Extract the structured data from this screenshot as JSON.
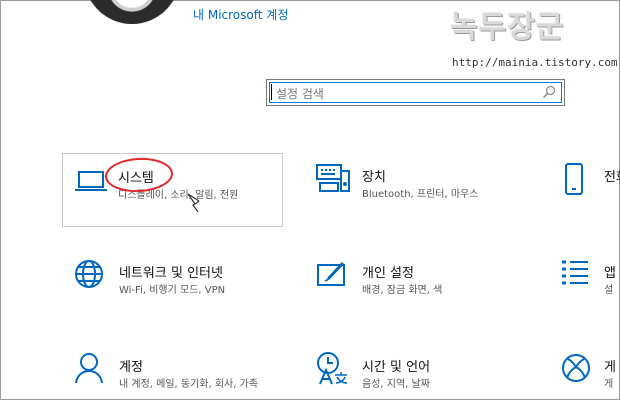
{
  "account": {
    "link_text": "내 Microsoft 계정"
  },
  "watermark": {
    "title": "녹두장군",
    "url": "http://mainia.tistory.com"
  },
  "search": {
    "placeholder": "설정 검색",
    "icon": "search-icon"
  },
  "tiles": [
    {
      "id": "system",
      "title": "시스템",
      "desc": "디스플레이, 소리, 알림, 전원",
      "icon": "laptop-icon",
      "selected": true
    },
    {
      "id": "devices",
      "title": "장치",
      "desc": "Bluetooth, 프린터, 마우스",
      "icon": "keyboard-devices-icon"
    },
    {
      "id": "phone",
      "title": "전화",
      "desc": "",
      "icon": "phone-icon"
    },
    {
      "id": "network",
      "title": "네트워크 및 인터넷",
      "desc": "Wi-Fi, 비행기 모드, VPN",
      "icon": "globe-icon"
    },
    {
      "id": "personalization",
      "title": "개인 설정",
      "desc": "배경, 잠금 화면, 색",
      "icon": "paint-icon"
    },
    {
      "id": "apps",
      "title": "앱",
      "desc": "설",
      "icon": "apps-list-icon"
    },
    {
      "id": "accounts",
      "title": "계정",
      "desc": "내 계정, 메일, 동기화, 회사, 가족",
      "icon": "person-icon"
    },
    {
      "id": "time",
      "title": "시간 및 언어",
      "desc": "음성, 지역, 날짜",
      "icon": "time-language-icon"
    },
    {
      "id": "gaming",
      "title": "게",
      "desc": "게",
      "icon": "xbox-icon"
    }
  ],
  "colors": {
    "accent": "#0067c0",
    "annotation": "#e0262b"
  }
}
